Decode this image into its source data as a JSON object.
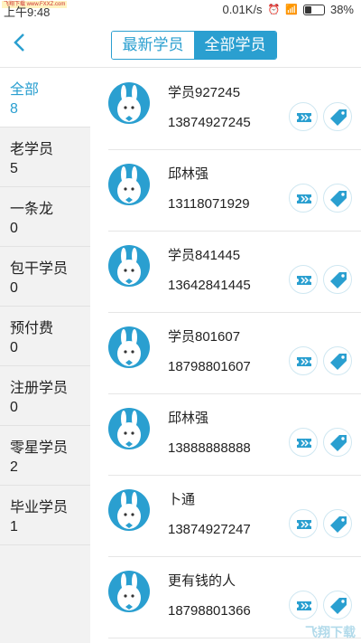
{
  "status": {
    "time": "上午9:48",
    "site": "飞翔下载 www.FXXZ.com",
    "speed": "0.01K/s",
    "battery": "38%"
  },
  "header": {
    "tabs": [
      {
        "label": "最新学员"
      },
      {
        "label": "全部学员"
      }
    ]
  },
  "sidebar": {
    "items": [
      {
        "label": "全部",
        "count": "8"
      },
      {
        "label": "老学员",
        "count": "5"
      },
      {
        "label": "一条龙",
        "count": "0"
      },
      {
        "label": "包干学员",
        "count": "0"
      },
      {
        "label": "预付费",
        "count": "0"
      },
      {
        "label": "注册学员",
        "count": "0"
      },
      {
        "label": "零星学员",
        "count": "2"
      },
      {
        "label": "毕业学员",
        "count": "1"
      }
    ]
  },
  "students": [
    {
      "name": "学员927245",
      "phone": "13874927245"
    },
    {
      "name": "邱林强",
      "phone": "13118071929"
    },
    {
      "name": "学员841445",
      "phone": "13642841445"
    },
    {
      "name": "学员801607",
      "phone": "18798801607"
    },
    {
      "name": "邱林强",
      "phone": "13888888888"
    },
    {
      "name": "卜通",
      "phone": "13874927247"
    },
    {
      "name": "更有钱的人",
      "phone": "18798801366"
    }
  ],
  "watermark": "飞翔下载",
  "colors": {
    "accent": "#2a9fd0"
  }
}
